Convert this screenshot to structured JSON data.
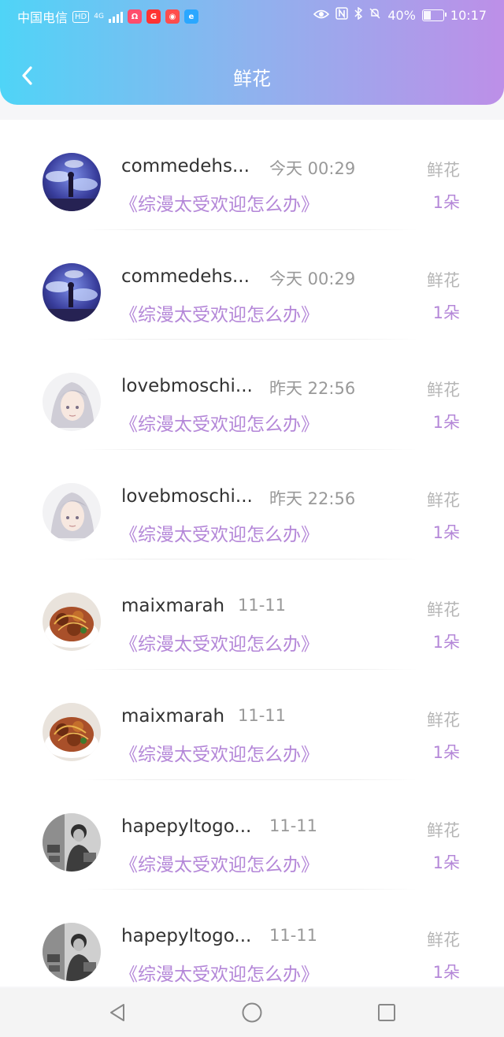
{
  "status_bar": {
    "carrier": "中国电信",
    "hd": "HD",
    "network": "4G",
    "battery": "40%",
    "battery_level": 0.4,
    "time": "10:17"
  },
  "header": {
    "title": "鲜花"
  },
  "records": [
    {
      "username": "commedehs...",
      "time": "今天 00:29",
      "book": "《综漫太受欢迎怎么办》",
      "gift": "鲜花",
      "count": "1朵",
      "avatar": "night-sky"
    },
    {
      "username": "commedehs...",
      "time": "今天 00:29",
      "book": "《综漫太受欢迎怎么办》",
      "gift": "鲜花",
      "count": "1朵",
      "avatar": "night-sky"
    },
    {
      "username": "lovebmoschi...",
      "time": "昨天 22:56",
      "book": "《综漫太受欢迎怎么办》",
      "gift": "鲜花",
      "count": "1朵",
      "avatar": "anime-silver"
    },
    {
      "username": "lovebmoschi...",
      "time": "昨天 22:56",
      "book": "《综漫太受欢迎怎么办》",
      "gift": "鲜花",
      "count": "1朵",
      "avatar": "anime-silver"
    },
    {
      "username": "maixmarah",
      "time": "11-11",
      "book": "《综漫太受欢迎怎么办》",
      "gift": "鲜花",
      "count": "1朵",
      "avatar": "food"
    },
    {
      "username": "maixmarah",
      "time": "11-11",
      "book": "《综漫太受欢迎怎么办》",
      "gift": "鲜花",
      "count": "1朵",
      "avatar": "food"
    },
    {
      "username": "hapepyltogo...",
      "time": "11-11",
      "book": "《综漫太受欢迎怎么办》",
      "gift": "鲜花",
      "count": "1朵",
      "avatar": "bw-photo"
    },
    {
      "username": "hapepyltogo...",
      "time": "11-11",
      "book": "《综漫太受欢迎怎么办》",
      "gift": "鲜花",
      "count": "1朵",
      "avatar": "bw-photo"
    }
  ],
  "nav_bar": {
    "back": "nav-back-icon",
    "home": "nav-home-icon",
    "recents": "nav-recents-icon"
  },
  "colors": {
    "header_start": "#4fd4f7",
    "header_end": "#bd8fe8",
    "accent_purple": "#b487d8"
  }
}
